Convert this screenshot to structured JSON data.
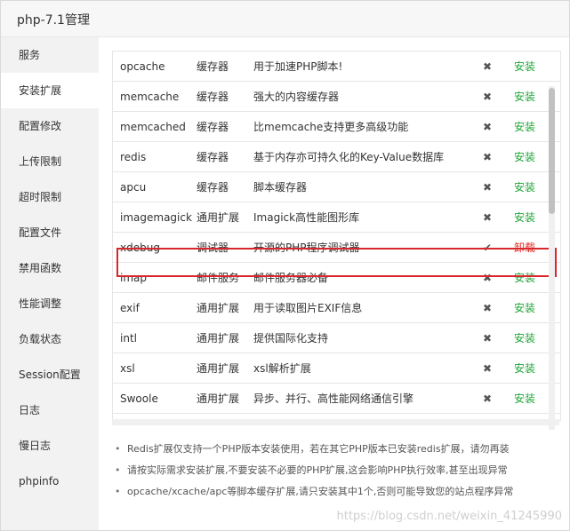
{
  "window": {
    "title": "php-7.1管理"
  },
  "sidebar": {
    "items": [
      {
        "label": "服务"
      },
      {
        "label": "安装扩展"
      },
      {
        "label": "配置修改"
      },
      {
        "label": "上传限制"
      },
      {
        "label": "超时限制"
      },
      {
        "label": "配置文件"
      },
      {
        "label": "禁用函数"
      },
      {
        "label": "性能调整"
      },
      {
        "label": "负载状态"
      },
      {
        "label": "Session配置"
      },
      {
        "label": "日志"
      },
      {
        "label": "慢日志"
      },
      {
        "label": "phpinfo"
      }
    ],
    "active_index": 1
  },
  "extensions": {
    "rows": [
      {
        "name": "opcache",
        "type": "缓存器",
        "desc": "用于加速PHP脚本!",
        "status": "✖",
        "action": "安装"
      },
      {
        "name": "memcache",
        "type": "缓存器",
        "desc": "强大的内容缓存器",
        "status": "✖",
        "action": "安装"
      },
      {
        "name": "memcached",
        "type": "缓存器",
        "desc": "比memcache支持更多高级功能",
        "status": "✖",
        "action": "安装"
      },
      {
        "name": "redis",
        "type": "缓存器",
        "desc": "基于内存亦可持久化的Key-Value数据库",
        "status": "✖",
        "action": "安装"
      },
      {
        "name": "apcu",
        "type": "缓存器",
        "desc": "脚本缓存器",
        "status": "✖",
        "action": "安装"
      },
      {
        "name": "imagemagick",
        "type": "通用扩展",
        "desc": "Imagick高性能图形库",
        "status": "✖",
        "action": "安装"
      },
      {
        "name": "xdebug",
        "type": "调试器",
        "desc": "开源的PHP程序调试器",
        "status": "✔",
        "action": "卸载"
      },
      {
        "name": "imap",
        "type": "邮件服务",
        "desc": "邮件服务器必备",
        "status": "✖",
        "action": "安装"
      },
      {
        "name": "exif",
        "type": "通用扩展",
        "desc": "用于读取图片EXIF信息",
        "status": "✖",
        "action": "安装"
      },
      {
        "name": "intl",
        "type": "通用扩展",
        "desc": "提供国际化支持",
        "status": "✖",
        "action": "安装"
      },
      {
        "name": "xsl",
        "type": "通用扩展",
        "desc": "xsl解析扩展",
        "status": "✖",
        "action": "安装"
      },
      {
        "name": "Swoole",
        "type": "通用扩展",
        "desc": "异步、并行、高性能网络通信引擎",
        "status": "✖",
        "action": "安装"
      }
    ],
    "install_color": "#20a53a",
    "uninstall_color": "#e3281f",
    "highlight_color": "#d9262a"
  },
  "notes": [
    "Redis扩展仅支持一个PHP版本安装使用，若在其它PHP版本已安装redis扩展，请勿再装",
    "请按实际需求安装扩展,不要安装不必要的PHP扩展,这会影响PHP执行效率,甚至出现异常",
    "opcache/xcache/apc等脚本缓存扩展,请只安装其中1个,否则可能导致您的站点程序异常"
  ],
  "watermark": "https://blog.csdn.net/weixin_41245990"
}
